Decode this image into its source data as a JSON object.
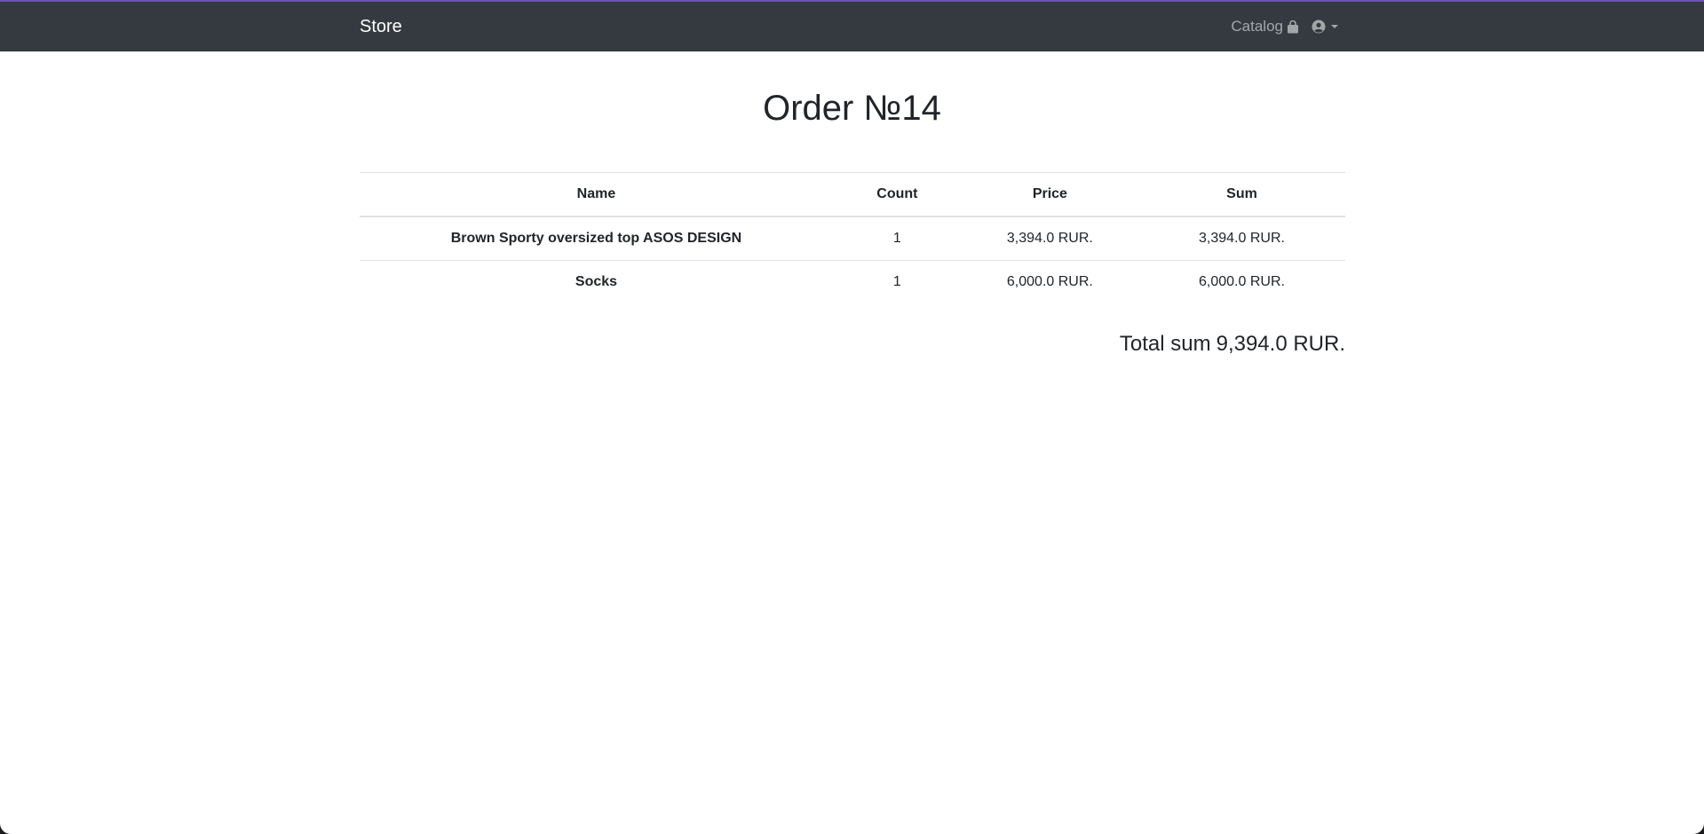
{
  "navbar": {
    "brand": "Store",
    "catalog_label": "Catalog",
    "catalog_icon": "shopping-bag-icon",
    "user_icon": "user-circle-icon",
    "dropdown_icon": "caret-down-icon"
  },
  "order": {
    "title": "Order №14",
    "columns": [
      "Name",
      "Count",
      "Price",
      "Sum"
    ],
    "rows": [
      {
        "name": "Brown Sporty oversized top ASOS DESIGN",
        "count": "1",
        "price": "3,394.0 RUR.",
        "sum": "3,394.0 RUR."
      },
      {
        "name": "Socks",
        "count": "1",
        "price": "6,000.0 RUR.",
        "sum": "6,000.0 RUR."
      }
    ],
    "total_label": "Total sum",
    "total_value": "9,394.0 RUR."
  },
  "colors": {
    "navbar_bg": "#343a40",
    "accent": "#6f4fc2",
    "text": "#212529"
  }
}
